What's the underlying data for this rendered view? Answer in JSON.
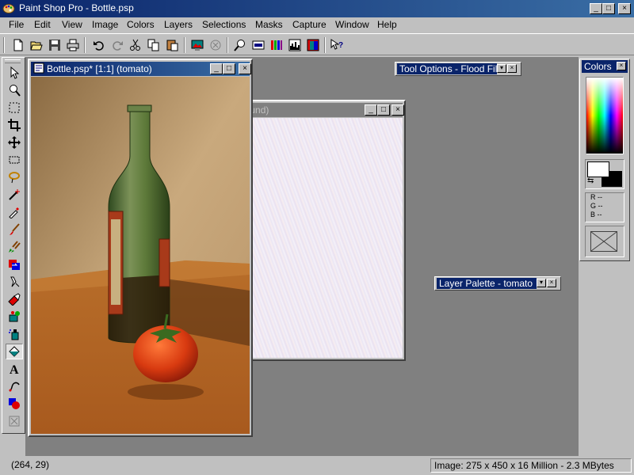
{
  "app": {
    "title": "Paint Shop Pro - Bottle.psp",
    "icon": "palette-icon"
  },
  "caption_buttons": {
    "minimize": "_",
    "maximize": "□",
    "close": "×"
  },
  "menu": [
    {
      "label": "File"
    },
    {
      "label": "Edit"
    },
    {
      "label": "View"
    },
    {
      "label": "Image"
    },
    {
      "label": "Colors"
    },
    {
      "label": "Layers"
    },
    {
      "label": "Selections"
    },
    {
      "label": "Masks"
    },
    {
      "label": "Capture"
    },
    {
      "label": "Window"
    },
    {
      "label": "Help"
    }
  ],
  "toolbar": [
    "new-file-icon",
    "open-folder-icon",
    "save-icon",
    "print-icon",
    "undo-icon",
    "redo-icon",
    "cut-icon",
    "copy-icon",
    "paste-icon",
    "full-screen-preview-icon",
    "browse-icon",
    "zoom-icon",
    "overview-icon",
    "histogram-icon",
    "color-balance-icon",
    "layer-palette-icon",
    "context-help-icon"
  ],
  "tools": [
    "arrow-icon",
    "zoom-tool-icon",
    "deformation-icon",
    "crop-icon",
    "mover-icon",
    "selection-icon",
    "freehand-selection-icon",
    "magic-wand-icon",
    "dropper-icon",
    "paintbrush-icon",
    "clone-brush-icon",
    "color-replacer-icon",
    "retouch-icon",
    "eraser-icon",
    "picture-tube-icon",
    "airbrush-icon",
    "flood-fill-icon",
    "text-icon",
    "line-icon",
    "shapes-icon",
    "preset-shapes-icon"
  ],
  "active_tool": "flood-fill-icon",
  "windows": {
    "bottle": {
      "title": "Bottle.psp* [1:1] (tomato)"
    },
    "background": {
      "title": "kground)"
    }
  },
  "palettes": {
    "tool_options": {
      "title": "Tool Options - Flood Fill"
    },
    "layer": {
      "title": "Layer Palette - tomato"
    },
    "colors": {
      "title": "Colors",
      "foreground": "#ffffff",
      "background": "#000000",
      "r_label": "R --",
      "g_label": "G --",
      "b_label": "B --"
    }
  },
  "status": {
    "coords": "(264, 29)",
    "image_info": "Image:  275 x 450 x 16 Million - 2.3 MBytes"
  }
}
